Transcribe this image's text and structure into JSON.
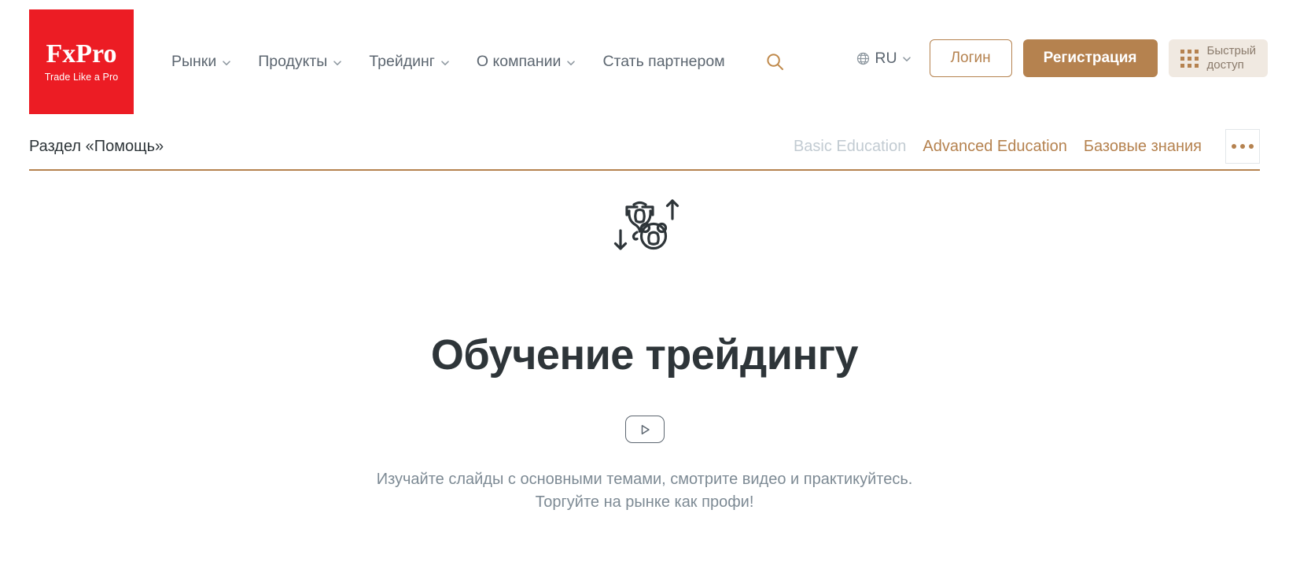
{
  "header": {
    "logo": {
      "word": "FxPro",
      "tagline": "Trade Like a Pro",
      "bg": "#EC1C24"
    },
    "nav": [
      {
        "label": "Рынки",
        "has_chevron": true
      },
      {
        "label": "Продукты",
        "has_chevron": true
      },
      {
        "label": "Трейдинг",
        "has_chevron": true
      },
      {
        "label": "О компании",
        "has_chevron": true
      },
      {
        "label": "Стать партнером",
        "has_chevron": false
      }
    ],
    "search_icon": "search-icon",
    "language": {
      "icon": "globe-icon",
      "value": "RU",
      "chevron": "chevron-down-icon"
    },
    "login_label": "Логин",
    "register_label": "Регистрация",
    "quick_access_label": "Быстрый\nдоступ",
    "quick_access_icon": "grid-dots-icon",
    "accent_color": "#B5824F"
  },
  "subnav": {
    "title": "Раздел «Помощь»",
    "tabs": [
      {
        "label": "Basic Education",
        "state": "inactive"
      },
      {
        "label": "Advanced Education",
        "state": "active"
      },
      {
        "label": "Базовые знания",
        "state": "active"
      }
    ],
    "more_icon": "ellipsis-icon",
    "underline_color": "#B5824F"
  },
  "hero": {
    "icon": "bull-bear-icon",
    "title": "Обучение трейдингу",
    "play_icon": "play-icon",
    "description_line1": "Изучайте слайды с основными темами, смотрите видео и практикуйтесь.",
    "description_line2": "Торгуйте на рынке как профи!"
  }
}
